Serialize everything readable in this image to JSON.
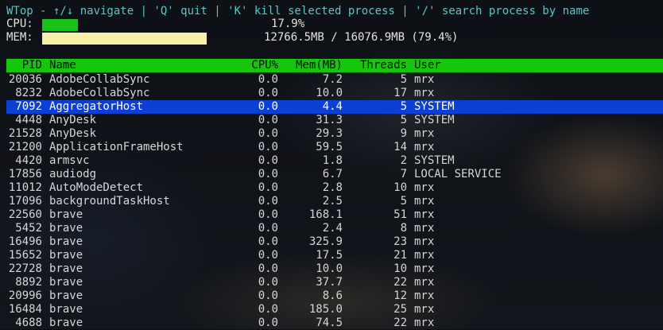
{
  "title": "WTop - ↑/↓ navigate | 'Q' quit | 'K' kill selected process | '/' search process by name",
  "cpu": {
    "label": "CPU:",
    "value_text": "17.9%",
    "fraction": 0.179,
    "bar_color": "#19c219"
  },
  "mem": {
    "label": "MEM:",
    "value_text": "12766.5MB / 16076.9MB (79.4%)",
    "fraction": 0.794,
    "bar_color": "#f6f0a8"
  },
  "table": {
    "header_color": "#16c60c",
    "selected_color": "#0b3fd6",
    "headers": {
      "pid": "PID",
      "name": "Name",
      "cpu": "CPU%",
      "mem": "Mem(MB)",
      "threads": "Threads",
      "user": "User"
    },
    "rows": [
      {
        "pid": "20036",
        "name": "AdobeCollabSync",
        "cpu": "0.0",
        "mem": "7.2",
        "threads": "5",
        "user": "mrx",
        "selected": false
      },
      {
        "pid": "8232",
        "name": "AdobeCollabSync",
        "cpu": "0.0",
        "mem": "10.0",
        "threads": "17",
        "user": "mrx",
        "selected": false
      },
      {
        "pid": "7092",
        "name": "AggregatorHost",
        "cpu": "0.0",
        "mem": "4.4",
        "threads": "5",
        "user": "SYSTEM",
        "selected": true
      },
      {
        "pid": "4448",
        "name": "AnyDesk",
        "cpu": "0.0",
        "mem": "31.3",
        "threads": "5",
        "user": "SYSTEM",
        "selected": false
      },
      {
        "pid": "21528",
        "name": "AnyDesk",
        "cpu": "0.0",
        "mem": "29.3",
        "threads": "9",
        "user": "mrx",
        "selected": false
      },
      {
        "pid": "21200",
        "name": "ApplicationFrameHost",
        "cpu": "0.0",
        "mem": "59.5",
        "threads": "14",
        "user": "mrx",
        "selected": false
      },
      {
        "pid": "4420",
        "name": "armsvc",
        "cpu": "0.0",
        "mem": "1.8",
        "threads": "2",
        "user": "SYSTEM",
        "selected": false
      },
      {
        "pid": "17856",
        "name": "audiodg",
        "cpu": "0.0",
        "mem": "6.7",
        "threads": "7",
        "user": "LOCAL SERVICE",
        "selected": false
      },
      {
        "pid": "11012",
        "name": "AutoModeDetect",
        "cpu": "0.0",
        "mem": "2.8",
        "threads": "10",
        "user": "mrx",
        "selected": false
      },
      {
        "pid": "17096",
        "name": "backgroundTaskHost",
        "cpu": "0.0",
        "mem": "2.5",
        "threads": "5",
        "user": "mrx",
        "selected": false
      },
      {
        "pid": "22560",
        "name": "brave",
        "cpu": "0.0",
        "mem": "168.1",
        "threads": "51",
        "user": "mrx",
        "selected": false
      },
      {
        "pid": "5452",
        "name": "brave",
        "cpu": "0.0",
        "mem": "2.4",
        "threads": "8",
        "user": "mrx",
        "selected": false
      },
      {
        "pid": "16496",
        "name": "brave",
        "cpu": "0.0",
        "mem": "325.9",
        "threads": "23",
        "user": "mrx",
        "selected": false
      },
      {
        "pid": "15652",
        "name": "brave",
        "cpu": "0.0",
        "mem": "17.5",
        "threads": "21",
        "user": "mrx",
        "selected": false
      },
      {
        "pid": "22728",
        "name": "brave",
        "cpu": "0.0",
        "mem": "10.0",
        "threads": "10",
        "user": "mrx",
        "selected": false
      },
      {
        "pid": "8892",
        "name": "brave",
        "cpu": "0.0",
        "mem": "37.7",
        "threads": "22",
        "user": "mrx",
        "selected": false
      },
      {
        "pid": "20996",
        "name": "brave",
        "cpu": "0.0",
        "mem": "8.6",
        "threads": "12",
        "user": "mrx",
        "selected": false
      },
      {
        "pid": "16484",
        "name": "brave",
        "cpu": "0.0",
        "mem": "185.0",
        "threads": "25",
        "user": "mrx",
        "selected": false
      },
      {
        "pid": "4688",
        "name": "brave",
        "cpu": "0.0",
        "mem": "74.5",
        "threads": "22",
        "user": "mrx",
        "selected": false
      }
    ]
  }
}
